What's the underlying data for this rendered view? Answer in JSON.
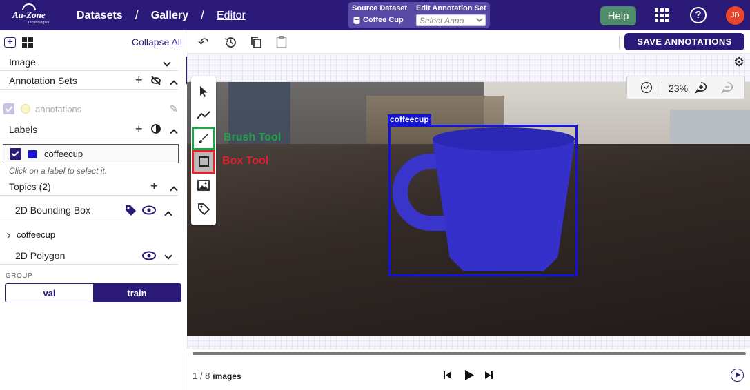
{
  "logo": {
    "name": "Au-Zone",
    "sub": "Technologies"
  },
  "nav": {
    "datasets": "Datasets",
    "sep1": "/",
    "gallery": "Gallery",
    "sep2": "/",
    "editor": "Editor"
  },
  "dataset_box": {
    "source_label": "Source Dataset",
    "source_value": "Coffee Cup",
    "edit_label": "Edit Annotation Set",
    "edit_placeholder": "Select Anno"
  },
  "header": {
    "help": "Help",
    "avatar": "JD"
  },
  "left_panel": {
    "collapse_all": "Collapse All",
    "image": "Image",
    "annotation_sets": "Annotation Sets",
    "annotation_set_name": "annotations",
    "labels": "Labels",
    "label_item": "coffeecup",
    "label_color": "#1a16d9",
    "hint": "Click on a label to select it.",
    "topics": "Topics (2)",
    "topic_bbox": "2D Bounding Box",
    "topic_bbox_child": "coffeecup",
    "topic_polygon": "2D Polygon",
    "group_label": "GROUP",
    "group_options": [
      "val",
      "train"
    ],
    "group_selected": "train"
  },
  "toolbar": {
    "save": "SAVE ANNOTATIONS"
  },
  "canvas": {
    "bbox_label": "coffeecup",
    "zoom": "23%",
    "captions": {
      "brush": "Brush Tool",
      "box": "Box Tool"
    }
  },
  "player": {
    "page": "1 / 8",
    "unit": "images"
  },
  "colors": {
    "brand": "#2c1a78",
    "bbox": "#1414d6",
    "brush_highlight": "#22a24a",
    "box_highlight": "#e3202c"
  }
}
